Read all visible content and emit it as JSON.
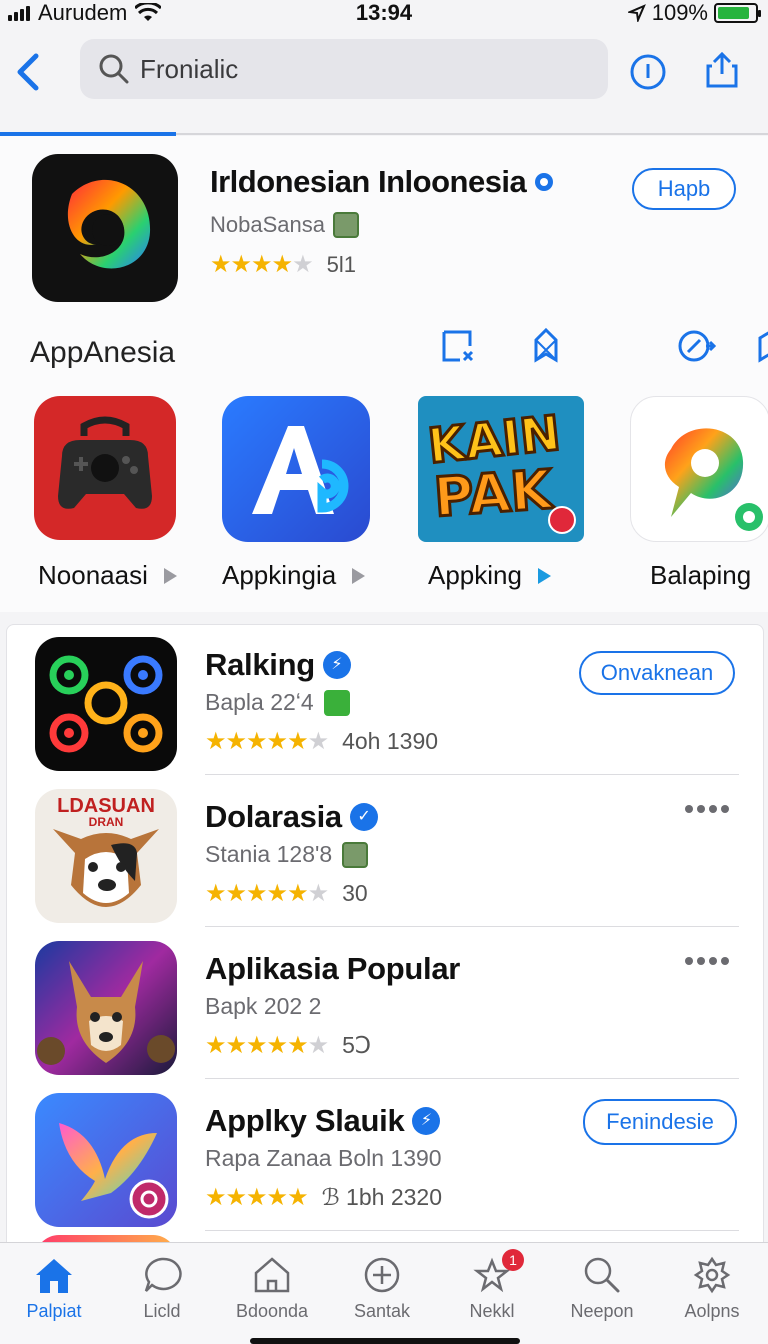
{
  "status": {
    "carrier": "Aurudem",
    "time": "13:94",
    "battery": "109%"
  },
  "search": {
    "value": "Fronialic"
  },
  "featured": {
    "title": "Irldonesian Inloonesia",
    "developer": "NobaSansa",
    "rating_count": "5l1",
    "rating": 4,
    "button_label": "Hapb"
  },
  "section": {
    "title": "AppAnesia",
    "items": [
      {
        "label": "Noonaasi"
      },
      {
        "label": "Appkingia"
      },
      {
        "label": "Appking"
      },
      {
        "label": "Balaping"
      }
    ],
    "kapak_text_1": "KAIN",
    "kapak_text_2": "PAK"
  },
  "list": [
    {
      "title": "Ralking",
      "sub": "Bapla 22ʻ4",
      "rating": 5,
      "count": "4oh 1390",
      "button": "Onvaknean"
    },
    {
      "title": "Dolarasia",
      "sub": "Stania 128'8",
      "rating": 5,
      "count": "30",
      "icon_text_1": "LDASUAN",
      "icon_text_2": "DRAN"
    },
    {
      "title": "Aplikasia Popular",
      "sub": "Bapk 202 2",
      "rating": 5,
      "count": "5Ↄ"
    },
    {
      "title": "Applky Slauik",
      "sub": "Rapa Zanaa Boln 1390",
      "rating": 5,
      "count": "ℬ 1bh 2320",
      "button": "Fenindesie"
    }
  ],
  "tabs": [
    {
      "label": "Palpiat"
    },
    {
      "label": "Licld"
    },
    {
      "label": "Bdoonda"
    },
    {
      "label": "Santak"
    },
    {
      "label": "Nekkl",
      "badge": "1"
    },
    {
      "label": "Neepon"
    },
    {
      "label": "Aolpns"
    }
  ],
  "colors": {
    "accent": "#1a73e8",
    "star": "#f5b301"
  }
}
